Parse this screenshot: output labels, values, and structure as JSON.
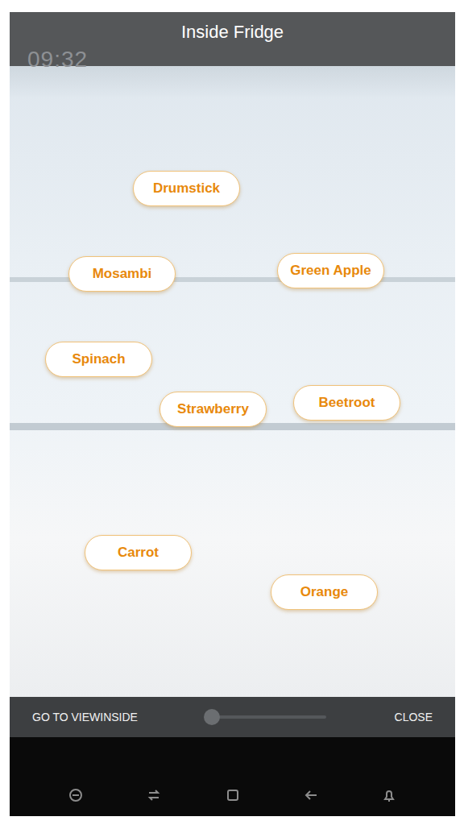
{
  "screen": {
    "title": "Inside Fridge",
    "clock": "09:32"
  },
  "labels": [
    {
      "text": "Drumstick"
    },
    {
      "text": "Mosambi"
    },
    {
      "text": "Green Apple"
    },
    {
      "text": "Spinach"
    },
    {
      "text": "Strawberry"
    },
    {
      "text": "Beetroot"
    },
    {
      "text": "Carrot"
    },
    {
      "text": "Orange"
    }
  ],
  "actions": {
    "left": "GO TO VIEWINSIDE",
    "right": "CLOSE"
  },
  "slider": {
    "level": 0.05
  }
}
